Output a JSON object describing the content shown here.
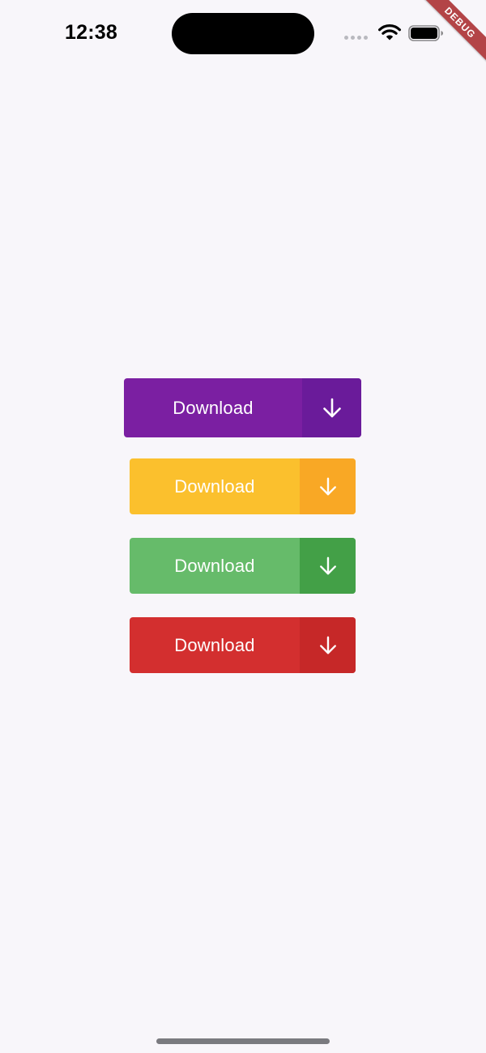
{
  "status_bar": {
    "time": "12:38"
  },
  "debug_banner": {
    "label": "DEBUG"
  },
  "buttons": [
    {
      "label": "Download",
      "icon": "arrow-down-icon",
      "color": "#7b1fa2",
      "icon_bg": "#6a1b9a"
    },
    {
      "label": "Download",
      "icon": "arrow-down-icon",
      "color": "#fbc02d",
      "icon_bg": "#f9a825"
    },
    {
      "label": "Download",
      "icon": "arrow-down-icon",
      "color": "#66bb6a",
      "icon_bg": "#43a047"
    },
    {
      "label": "Download",
      "icon": "arrow-down-icon",
      "color": "#d32f2f",
      "icon_bg": "#c62828"
    }
  ]
}
